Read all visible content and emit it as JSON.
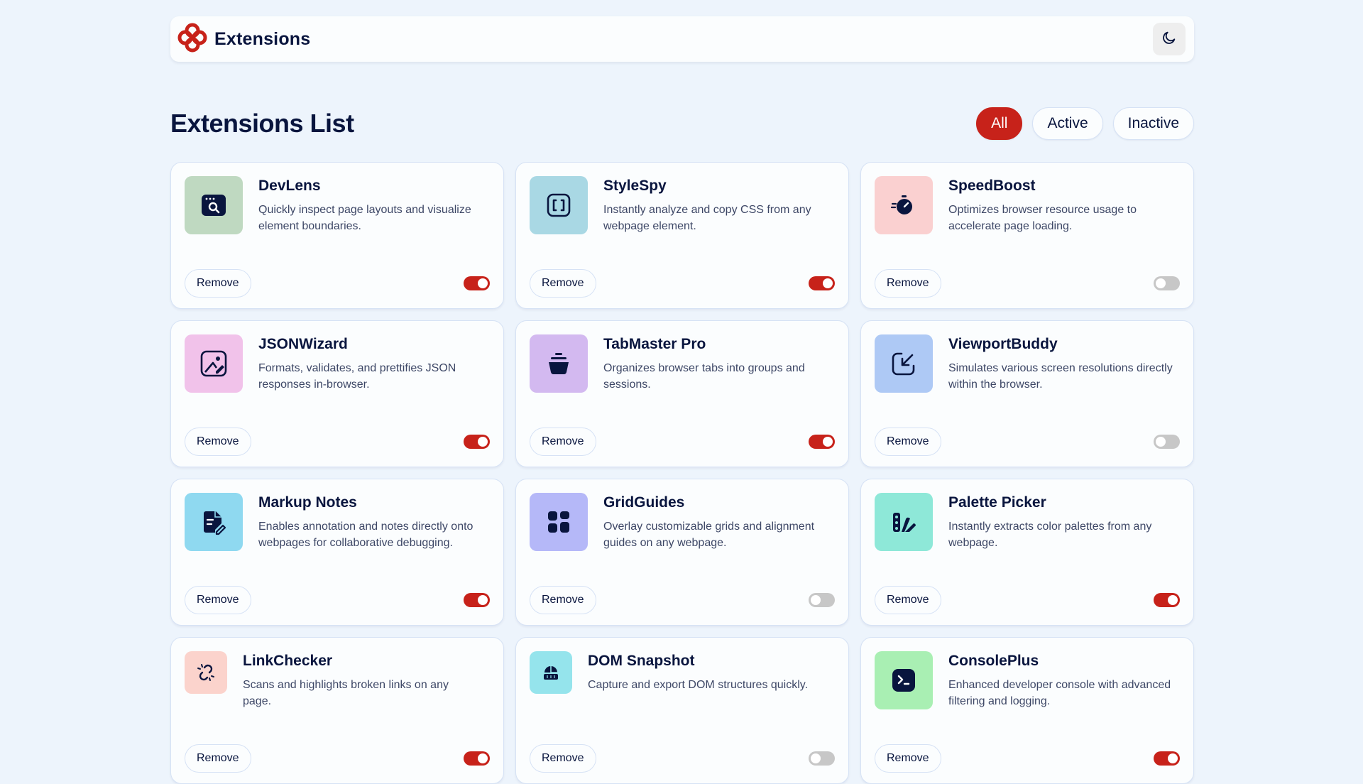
{
  "header": {
    "brand": "Extensions",
    "theme_icon": "moon-icon"
  },
  "list": {
    "title": "Extensions List",
    "filters": [
      {
        "label": "All",
        "active": true
      },
      {
        "label": "Active",
        "active": false
      },
      {
        "label": "Inactive",
        "active": false
      }
    ],
    "remove_label": "Remove"
  },
  "extensions": [
    {
      "name": "DevLens",
      "description": "Quickly inspect page layouts and visualize element boundaries.",
      "enabled": true,
      "icon": "inspect-window-icon",
      "icon_bg": "#bfd9c1"
    },
    {
      "name": "StyleSpy",
      "description": "Instantly analyze and copy CSS from any webpage element.",
      "enabled": true,
      "icon": "css-brackets-icon",
      "icon_bg": "#a9d8e4"
    },
    {
      "name": "SpeedBoost",
      "description": "Optimizes browser resource usage to accelerate page loading.",
      "enabled": false,
      "icon": "stopwatch-icon",
      "icon_bg": "#fad0d0"
    },
    {
      "name": "JSONWizard",
      "description": "Formats, validates, and prettifies JSON responses in-browser.",
      "enabled": true,
      "icon": "wand-image-icon",
      "icon_bg": "#f1c2ea"
    },
    {
      "name": "TabMaster Pro",
      "description": "Organizes browser tabs into groups and sessions.",
      "enabled": true,
      "icon": "bucket-icon",
      "icon_bg": "#d3b9f0"
    },
    {
      "name": "ViewportBuddy",
      "description": "Simulates various screen resolutions directly within the browser.",
      "enabled": false,
      "icon": "resize-arrow-icon",
      "icon_bg": "#aec9f5"
    },
    {
      "name": "Markup Notes",
      "description": "Enables annotation and notes directly onto webpages for collaborative debugging.",
      "enabled": true,
      "icon": "note-pen-icon",
      "icon_bg": "#8fd9f0"
    },
    {
      "name": "GridGuides",
      "description": "Overlay customizable grids and alignment guides on any webpage.",
      "enabled": false,
      "icon": "grid-blocks-icon",
      "icon_bg": "#b5b8f8"
    },
    {
      "name": "Palette Picker",
      "description": "Instantly extracts color palettes from any webpage.",
      "enabled": true,
      "icon": "palette-icon",
      "icon_bg": "#8ee8d8"
    },
    {
      "name": "LinkChecker",
      "description": "Scans and highlights broken links on any page.",
      "enabled": true,
      "icon": "broken-link-icon",
      "icon_bg": "#fbd3cc"
    },
    {
      "name": "DOM Snapshot",
      "description": "Capture and export DOM structures quickly.",
      "enabled": false,
      "icon": "snapshot-icon",
      "icon_bg": "#95e4ec"
    },
    {
      "name": "ConsolePlus",
      "description": "Enhanced developer console with advanced filtering and logging.",
      "enabled": true,
      "icon": "terminal-icon",
      "icon_bg": "#a9efb3"
    }
  ],
  "colors": {
    "accent": "#c7221a",
    "page_bg": "#edf4fc",
    "card_bg": "#fbfdfe",
    "text": "#09153e"
  }
}
